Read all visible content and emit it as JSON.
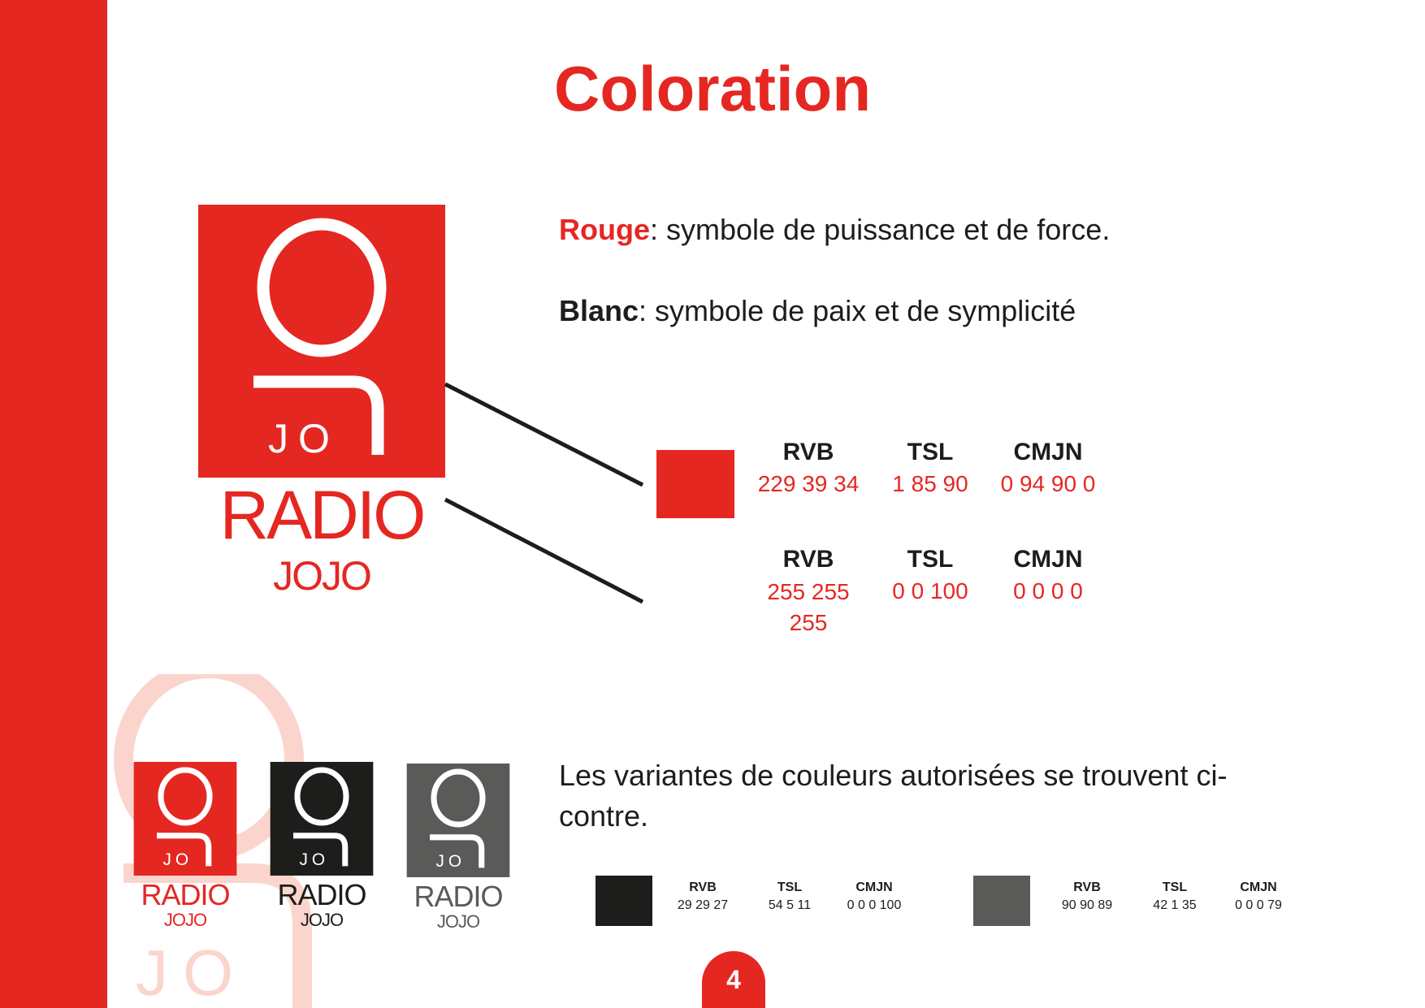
{
  "page": {
    "title": "Coloration",
    "page_number": "4"
  },
  "colors": {
    "brand_red": "#e52722",
    "black": "#1d1d1b",
    "dark_grey": "#5a5a59",
    "white": "#ffffff"
  },
  "descriptions": [
    {
      "term": "Rouge",
      "text": ": symbole de puissance et de force."
    },
    {
      "term": "Blanc",
      "text": ": symbole de paix et de symplicité"
    }
  ],
  "logo": {
    "mark": "JO",
    "radio": "RADIO",
    "jojo": "JOJO"
  },
  "swatch_specs": [
    {
      "swatch_color": "#e52722",
      "rvb_label": "RVB",
      "rvb_value": "229 39 34",
      "tsl_label": "TSL",
      "tsl_value": "1 85 90",
      "cmjn_label": "CMJN",
      "cmjn_value": "0 94 90 0"
    },
    {
      "swatch_color": "#ffffff",
      "rvb_label": "RVB",
      "rvb_value_line1": "255 255",
      "rvb_value_line2": "255",
      "tsl_label": "TSL",
      "tsl_value": "0 0 100",
      "cmjn_label": "CMJN",
      "cmjn_value": "0 0 0 0"
    }
  ],
  "variants_text": "Les variantes de couleurs autorisées se trouvent ci-contre.",
  "variant_specs": [
    {
      "swatch_color": "#1d1d1b",
      "rvb_label": "RVB",
      "rvb_value": "29 29 27",
      "tsl_label": "TSL",
      "tsl_value": "54 5 11",
      "cmjn_label": "CMJN",
      "cmjn_value": "0 0 0 100"
    },
    {
      "swatch_color": "#5a5a59",
      "rvb_label": "RVB",
      "rvb_value": "90 90 89",
      "tsl_label": "TSL",
      "tsl_value": "42 1 35",
      "cmjn_label": "CMJN",
      "cmjn_value": "0 0 0 79"
    }
  ]
}
